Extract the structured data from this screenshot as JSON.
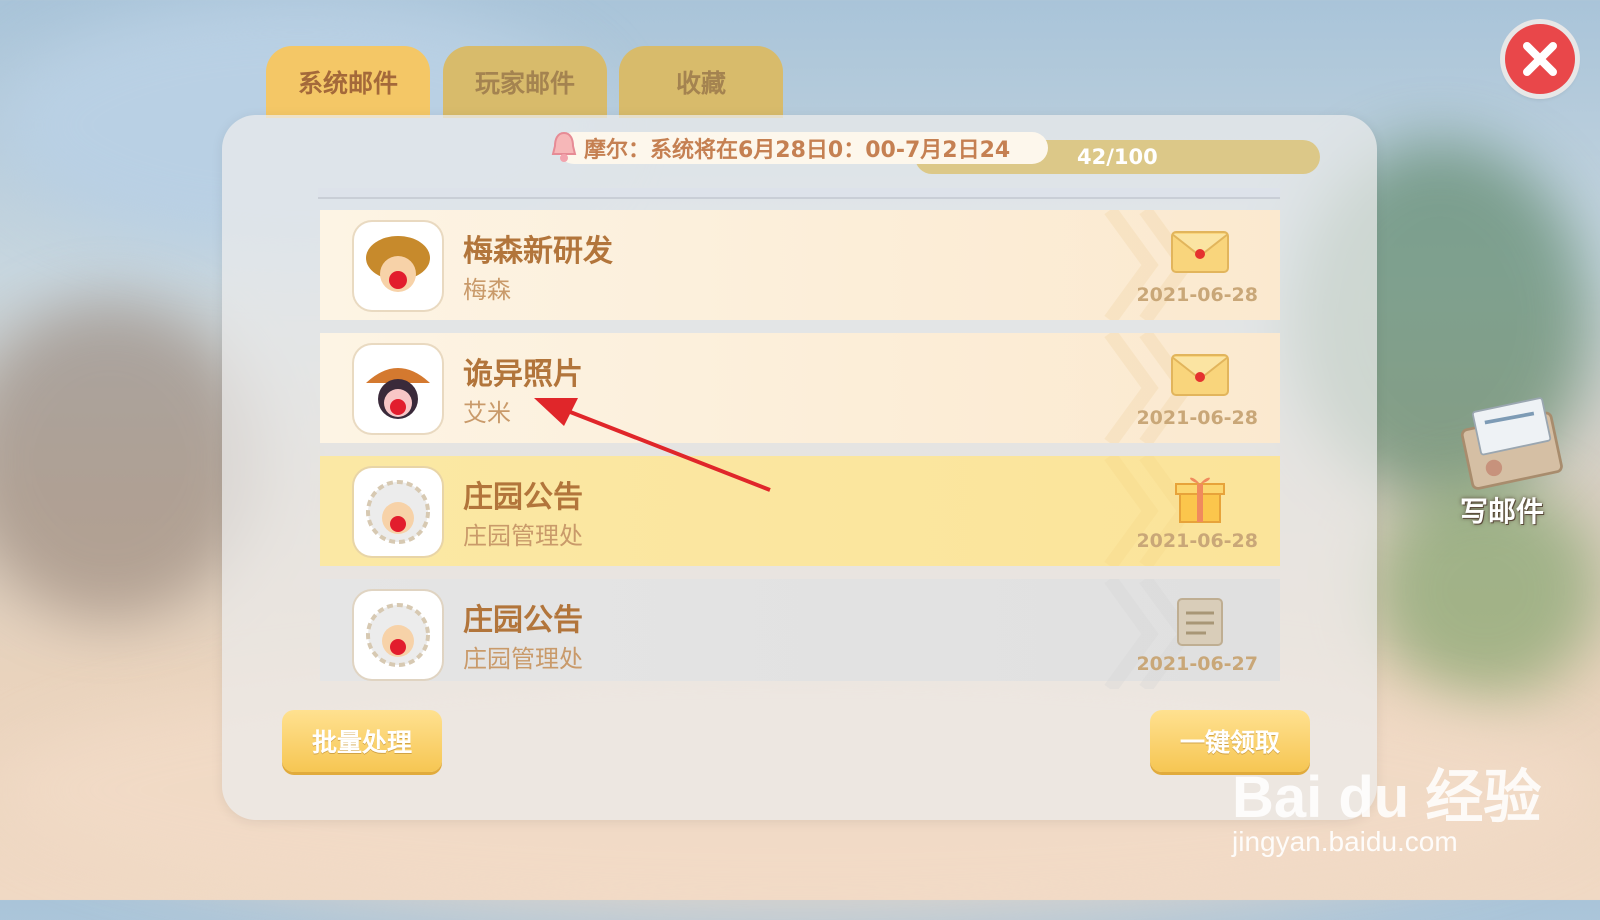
{
  "tabs": [
    {
      "label": "系统邮件",
      "active": true
    },
    {
      "label": "玩家邮件",
      "active": false
    },
    {
      "label": "收藏",
      "active": false
    }
  ],
  "notice": {
    "text": "摩尔：系统将在6月28日0：00-7月2日24"
  },
  "mail_count": "42/100",
  "mails": [
    {
      "title": "梅森新研发",
      "sender": "梅森",
      "date": "2021-06-28",
      "icon": "envelope-icon",
      "state": "unread"
    },
    {
      "title": "诡异照片",
      "sender": "艾米",
      "date": "2021-06-28",
      "icon": "envelope-icon",
      "state": "unread"
    },
    {
      "title": "庄园公告",
      "sender": "庄园管理处",
      "date": "2021-06-28",
      "icon": "gift-icon",
      "state": "highlight"
    },
    {
      "title": "庄园公告",
      "sender": "庄园管理处",
      "date": "2021-06-27",
      "icon": "document-icon",
      "state": "read"
    }
  ],
  "buttons": {
    "batch": "批量处理",
    "claim_all": "一键领取",
    "write_mail": "写邮件"
  },
  "watermark": {
    "logo": "Bai du 经验",
    "url": "jingyan.baidu.com"
  },
  "colors": {
    "accent": "#f4c766",
    "close": "#e9474a",
    "arrow": "#e0262a"
  }
}
